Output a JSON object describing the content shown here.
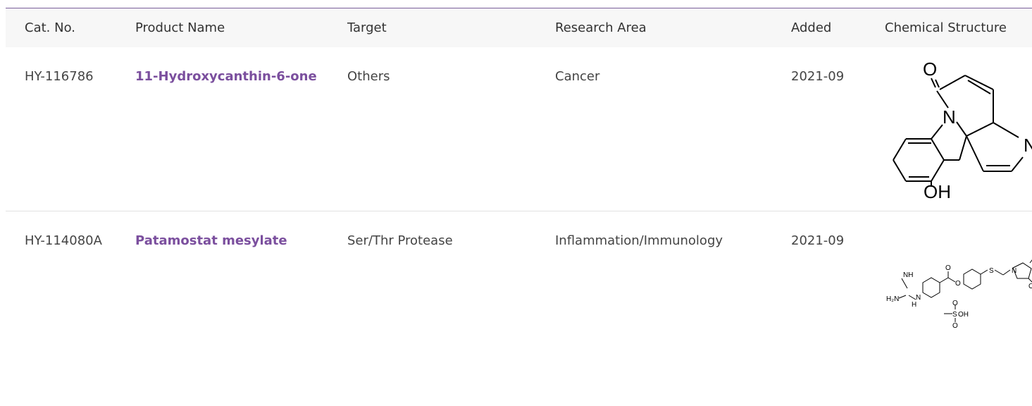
{
  "table": {
    "headers": [
      "Cat. No.",
      "Product Name",
      "Target",
      "Research Area",
      "Added",
      "Chemical Structure"
    ],
    "rows": [
      {
        "cat_no": "HY-116786",
        "product_name": "11-Hydroxycanthin-6-one",
        "target": "Others",
        "research_area": "Cancer",
        "added": "2021-09",
        "structure_atoms": [
          "O",
          "N",
          "N",
          "OH"
        ]
      },
      {
        "cat_no": "HY-114080A",
        "product_name": "Patamostat mesylate",
        "target": "Ser/Thr Protease",
        "research_area": "Inflammation/Immunology",
        "added": "2021-09",
        "structure_atoms": [
          "NH",
          "H₂N",
          "N",
          "H",
          "O",
          "O",
          "S",
          "N",
          "O",
          "O",
          "S",
          "OH",
          "O",
          "O"
        ]
      }
    ]
  },
  "colors": {
    "link": "#7b4f9e",
    "header_bg": "#f7f7f7",
    "top_rule": "#7a5f9a"
  }
}
